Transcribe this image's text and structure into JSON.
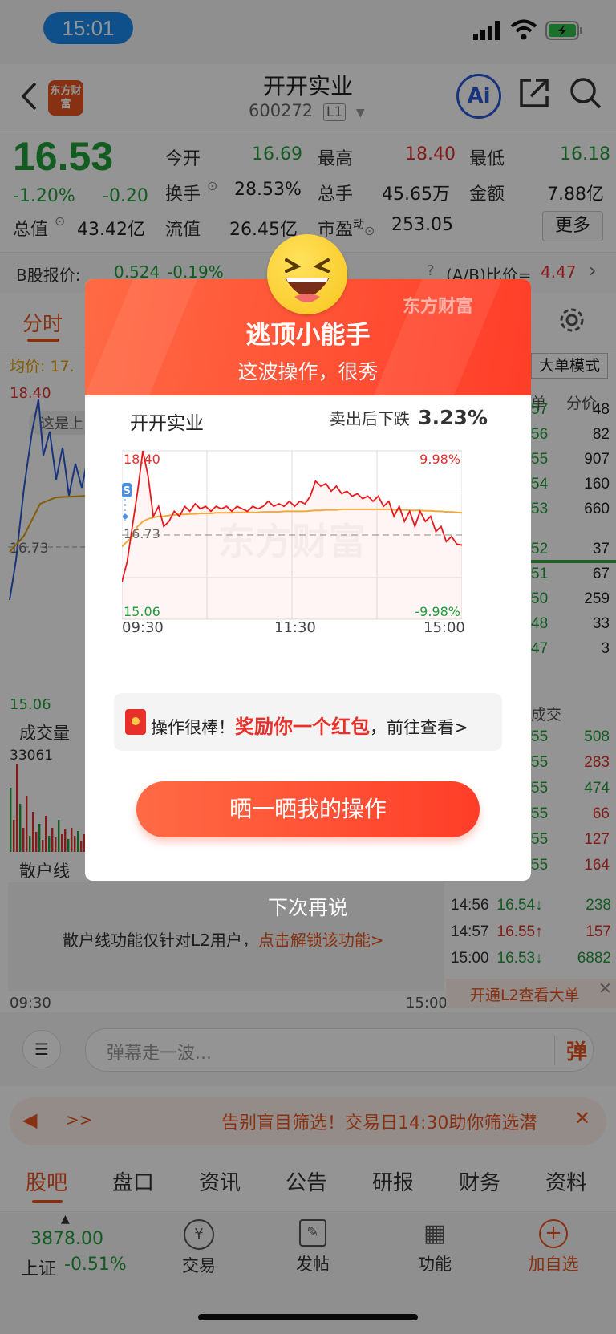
{
  "status": {
    "time": "15:01"
  },
  "header": {
    "title": "开开实业",
    "code": "600272",
    "level": "L1",
    "logo_text": "东方财富",
    "ai_label": "Ai"
  },
  "quote": {
    "price": "16.53",
    "change_pct": "-1.20%",
    "change": "-0.20",
    "open_label": "今开",
    "open": "16.69",
    "high_label": "最高",
    "high": "18.40",
    "low_label": "最低",
    "low": "16.18",
    "turnover_label": "换手",
    "turnover": "28.53%",
    "volume_label": "总手",
    "volume": "45.65万",
    "amount_label": "金额",
    "amount": "7.88亿",
    "mktcap_label": "总值",
    "mktcap": "43.42亿",
    "float_label": "流值",
    "float": "26.45亿",
    "pe_label": "市盈",
    "pe_sup": "动",
    "pe": "253.05",
    "more": "更多"
  },
  "bshare": {
    "label": "B股报价:",
    "price": "0.524",
    "pct": "-0.19%",
    "ratio_label": "(A/B)比价=",
    "ratio": "4.47"
  },
  "chart_tabs": {
    "intraday": "分时"
  },
  "intraday": {
    "avg_label": "均价:",
    "avg_val": "17.",
    "high": "18.40",
    "mid": "16.73",
    "low": "15.06",
    "tooltip": "这是上",
    "vol_label": "成交量",
    "vol_val": "33061",
    "retail_label": "散户线",
    "retail_note": "散户线功能仅针对L2用户，",
    "retail_link": "点击解锁该功能>",
    "t_start": "09:30",
    "t_end": "15:00",
    "bigorder_btn": "大单模式"
  },
  "depth": {
    "head_a": "单",
    "head_b": "分价",
    "rows": [
      {
        "p": "57",
        "v": "48"
      },
      {
        "p": "56",
        "v": "82"
      },
      {
        "p": "55",
        "v": "907"
      },
      {
        "p": "54",
        "v": "160"
      },
      {
        "p": "53",
        "v": "660"
      },
      {
        "p": "52",
        "v": "37"
      },
      {
        "p": "51",
        "v": "67"
      },
      {
        "p": "50",
        "v": "259"
      },
      {
        "p": "48",
        "v": "33"
      },
      {
        "p": "47",
        "v": "3"
      }
    ],
    "trade_head": "成交",
    "trades_partial": [
      {
        "p": "55",
        "v": "508"
      },
      {
        "p": "55",
        "v": "283"
      },
      {
        "p": "55",
        "v": "474"
      },
      {
        "p": "55",
        "v": "66"
      },
      {
        "p": "55",
        "v": "127"
      },
      {
        "p": "55",
        "v": "164"
      }
    ],
    "trades": [
      {
        "t": "14:56",
        "p": "16.54↓",
        "v": "238"
      },
      {
        "t": "14:57",
        "p": "16.55↑",
        "v": "157"
      },
      {
        "t": "15:00",
        "p": "16.53↓",
        "v": "6882"
      }
    ],
    "l2_banner": "开通L2查看大单"
  },
  "danmu": {
    "placeholder": "弹幕走一波...",
    "btn": "弹"
  },
  "ticker": {
    "arrows": ">>",
    "text": "告别盲目筛选！交易日14:30助你筛选潜"
  },
  "bottom_tabs": [
    "股吧",
    "盘口",
    "资讯",
    "公告",
    "研报",
    "财务",
    "资料"
  ],
  "bottom_bar": {
    "index_val": "3878.00",
    "index_name": "上证",
    "index_pct": "-0.51%",
    "trade": "交易",
    "post": "发帖",
    "func": "功能",
    "add": "加自选"
  },
  "modal": {
    "title": "逃顶小能手",
    "subtitle": "这波操作，很秀",
    "brand": "东方财富",
    "stock_name": "开开实业",
    "sell_label": "卖出后下跌",
    "sell_pct": "3.23%",
    "chart_watermark": "东方财富",
    "reward_prefix": "操作很棒！",
    "reward_highlight": "奖励你一个红包",
    "reward_suffix": "，前往查看>",
    "share_btn": "晒一晒我的操作",
    "later": "下次再说"
  },
  "chart_data": {
    "type": "line",
    "x_ticks": [
      "09:30",
      "11:30",
      "15:00"
    ],
    "ylim": [
      15.06,
      18.4
    ],
    "y_left_labels": {
      "top": "18.40",
      "mid": "16.73",
      "bottom": "15.06"
    },
    "y_right_labels": {
      "top": "9.98%",
      "bottom": "-9.98%"
    },
    "reference": 16.73,
    "sell_marker": "S",
    "series": [
      {
        "role": "price",
        "values": [
          15.8,
          16.2,
          16.9,
          17.6,
          18.4,
          17.9,
          17.1,
          17.3,
          16.9,
          17.0,
          17.2,
          17.1,
          17.3,
          17.2,
          17.35,
          17.25,
          17.3,
          17.2,
          17.3,
          17.25,
          17.3,
          17.2,
          17.3,
          17.25,
          17.2,
          17.3,
          17.25,
          17.3,
          17.4,
          17.3,
          17.35,
          17.3,
          17.4,
          17.3,
          17.4,
          17.35,
          17.5,
          17.8,
          17.7,
          17.75,
          17.6,
          17.7,
          17.55,
          17.6,
          17.5,
          17.55,
          17.45,
          17.5,
          17.4,
          17.5,
          17.3,
          17.4,
          17.1,
          17.3,
          17.0,
          17.2,
          16.9,
          17.2,
          17.0,
          17.1,
          16.8,
          16.9,
          16.6,
          16.7,
          16.55,
          16.53
        ]
      },
      {
        "role": "average",
        "values": [
          16.5,
          16.6,
          16.7,
          16.9,
          17.0,
          17.05,
          17.08,
          17.1,
          17.1,
          17.12,
          17.13,
          17.14,
          17.14,
          17.15,
          17.15,
          17.16,
          17.16,
          17.16,
          17.17,
          17.17,
          17.17,
          17.17,
          17.18,
          17.18,
          17.18,
          17.18,
          17.18,
          17.19,
          17.19,
          17.19,
          17.19,
          17.2,
          17.2,
          17.2,
          17.2,
          17.2,
          17.21,
          17.22,
          17.22,
          17.23,
          17.23,
          17.23,
          17.24,
          17.24,
          17.24,
          17.24,
          17.24,
          17.24,
          17.24,
          17.24,
          17.24,
          17.24,
          17.23,
          17.23,
          17.23,
          17.22,
          17.22,
          17.22,
          17.21,
          17.21,
          17.2,
          17.2,
          17.19,
          17.19,
          17.18,
          17.17
        ]
      }
    ]
  }
}
